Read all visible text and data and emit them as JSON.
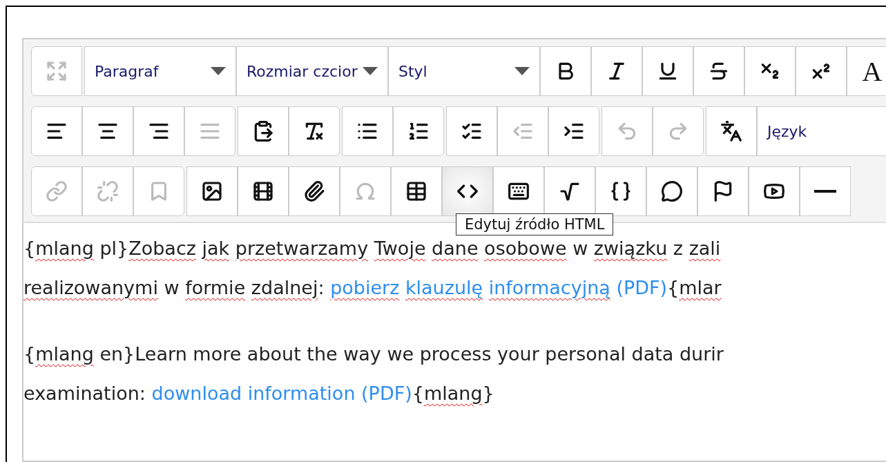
{
  "toolbar": {
    "rows": [
      [
        {
          "kind": "icon",
          "disabled": true,
          "group_end": true
        },
        {
          "kind": "dropdown",
          "label": "Paragraf",
          "wide": false
        },
        {
          "kind": "dropdown",
          "label": "Rozmiar czcior",
          "wide": false
        },
        {
          "kind": "dropdown",
          "label": "Styl",
          "wide": false
        },
        {
          "kind": "icon",
          "disabled": false
        },
        {
          "kind": "icon",
          "disabled": false
        },
        {
          "kind": "icon",
          "disabled": false
        },
        {
          "kind": "icon",
          "disabled": false
        },
        {
          "kind": "icon",
          "disabled": false
        },
        {
          "kind": "icon",
          "disabled": false
        },
        {
          "kind": "text",
          "label": "A"
        }
      ],
      [
        {
          "kind": "icon",
          "disabled": false
        },
        {
          "kind": "icon",
          "disabled": false
        },
        {
          "kind": "icon",
          "disabled": false
        },
        {
          "kind": "icon",
          "disabled": true,
          "group_end": true
        },
        {
          "kind": "icon",
          "disabled": false
        },
        {
          "kind": "icon",
          "disabled": false,
          "group_end": true
        },
        {
          "kind": "icon",
          "disabled": false
        },
        {
          "kind": "icon",
          "disabled": false,
          "group_end": true
        },
        {
          "kind": "icon",
          "disabled": false
        },
        {
          "kind": "icon",
          "disabled": true
        },
        {
          "kind": "icon",
          "disabled": false,
          "group_end": true
        },
        {
          "kind": "icon",
          "disabled": true
        },
        {
          "kind": "icon",
          "disabled": true,
          "group_end": true
        },
        {
          "kind": "icon",
          "disabled": false
        },
        {
          "kind": "dropdown",
          "label": "Język",
          "wide": true
        }
      ],
      [
        {
          "kind": "icon",
          "disabled": true
        },
        {
          "kind": "icon",
          "disabled": true
        },
        {
          "kind": "icon",
          "disabled": true,
          "group_end": true
        },
        {
          "kind": "icon",
          "disabled": false
        },
        {
          "kind": "icon",
          "disabled": false
        },
        {
          "kind": "icon",
          "disabled": false
        },
        {
          "kind": "icon",
          "disabled": true
        },
        {
          "kind": "icon",
          "disabled": false
        },
        {
          "kind": "icon",
          "disabled": false,
          "hovered": true
        },
        {
          "kind": "icon",
          "disabled": false
        },
        {
          "kind": "icon",
          "disabled": false
        },
        {
          "kind": "icon",
          "disabled": false
        },
        {
          "kind": "icon",
          "disabled": false
        },
        {
          "kind": "icon",
          "disabled": false
        },
        {
          "kind": "icon",
          "disabled": false
        },
        {
          "kind": "icon",
          "disabled": false
        }
      ]
    ]
  },
  "tooltip": "Edytuj źródło HTML",
  "paragraphs": [
    {
      "lines": [
        [
          [
            {
              "kind": "text",
              "text": "{",
              "misspelled": false
            },
            {
              "kind": "text",
              "text": "mlang",
              "misspelled": true
            }
          ],
          [
            {
              "kind": "text",
              "text": "pl}",
              "misspelled": false
            },
            {
              "kind": "text",
              "text": "Zobacz",
              "misspelled": true
            }
          ],
          [
            {
              "kind": "text",
              "text": "jak",
              "misspelled": true
            }
          ],
          [
            {
              "kind": "text",
              "text": "przetwarzamy",
              "misspelled": true
            }
          ],
          [
            {
              "kind": "text",
              "text": "Twoje",
              "misspelled": true
            }
          ],
          [
            {
              "kind": "text",
              "text": "dane",
              "misspelled": true
            }
          ],
          [
            {
              "kind": "text",
              "text": "osobowe",
              "misspelled": true
            }
          ],
          [
            {
              "kind": "text",
              "text": "w",
              "misspelled": false
            }
          ],
          [
            {
              "kind": "text",
              "text": "związku",
              "misspelled": true
            }
          ],
          [
            {
              "kind": "text",
              "text": "z",
              "misspelled": false
            }
          ],
          [
            {
              "kind": "text",
              "text": "zali",
              "misspelled": true
            }
          ]
        ],
        [
          [
            {
              "kind": "text",
              "text": "realizowanymi",
              "misspelled": true
            }
          ],
          [
            {
              "kind": "text",
              "text": "w",
              "misspelled": false
            }
          ],
          [
            {
              "kind": "text",
              "text": "formie",
              "misspelled": true
            }
          ],
          [
            {
              "kind": "text",
              "text": "zdalnej",
              "misspelled": true
            },
            {
              "kind": "text",
              "text": ":",
              "misspelled": false
            }
          ],
          [
            {
              "kind": "link",
              "words": [
                {
                  "text": "pobierz",
                  "misspelled": true
                },
                {
                  "text": "klauzulę",
                  "misspelled": true
                },
                {
                  "text": "informacyjną",
                  "misspelled": true
                },
                {
                  "text": "(PDF)",
                  "misspelled": false
                }
              ]
            },
            {
              "kind": "text",
              "text": "{",
              "misspelled": false
            },
            {
              "kind": "text",
              "text": "mlar",
              "misspelled": true
            }
          ]
        ]
      ]
    },
    {
      "lines": [
        [
          [
            {
              "kind": "text",
              "text": "{",
              "misspelled": false
            },
            {
              "kind": "text",
              "text": "mlang",
              "misspelled": true
            }
          ],
          [
            {
              "kind": "text",
              "text": "en}Learn more about the way we process your personal data durir",
              "misspelled": false
            }
          ]
        ],
        [
          [
            {
              "kind": "text",
              "text": "examination:",
              "misspelled": false
            }
          ],
          [
            {
              "kind": "link",
              "words": [
                {
                  "text": "download information (PDF)",
                  "misspelled": false
                }
              ]
            },
            {
              "kind": "text",
              "text": "{",
              "misspelled": false
            },
            {
              "kind": "text",
              "text": "mlang",
              "misspelled": true
            },
            {
              "kind": "text",
              "text": "}",
              "misspelled": false
            }
          ]
        ]
      ]
    }
  ]
}
